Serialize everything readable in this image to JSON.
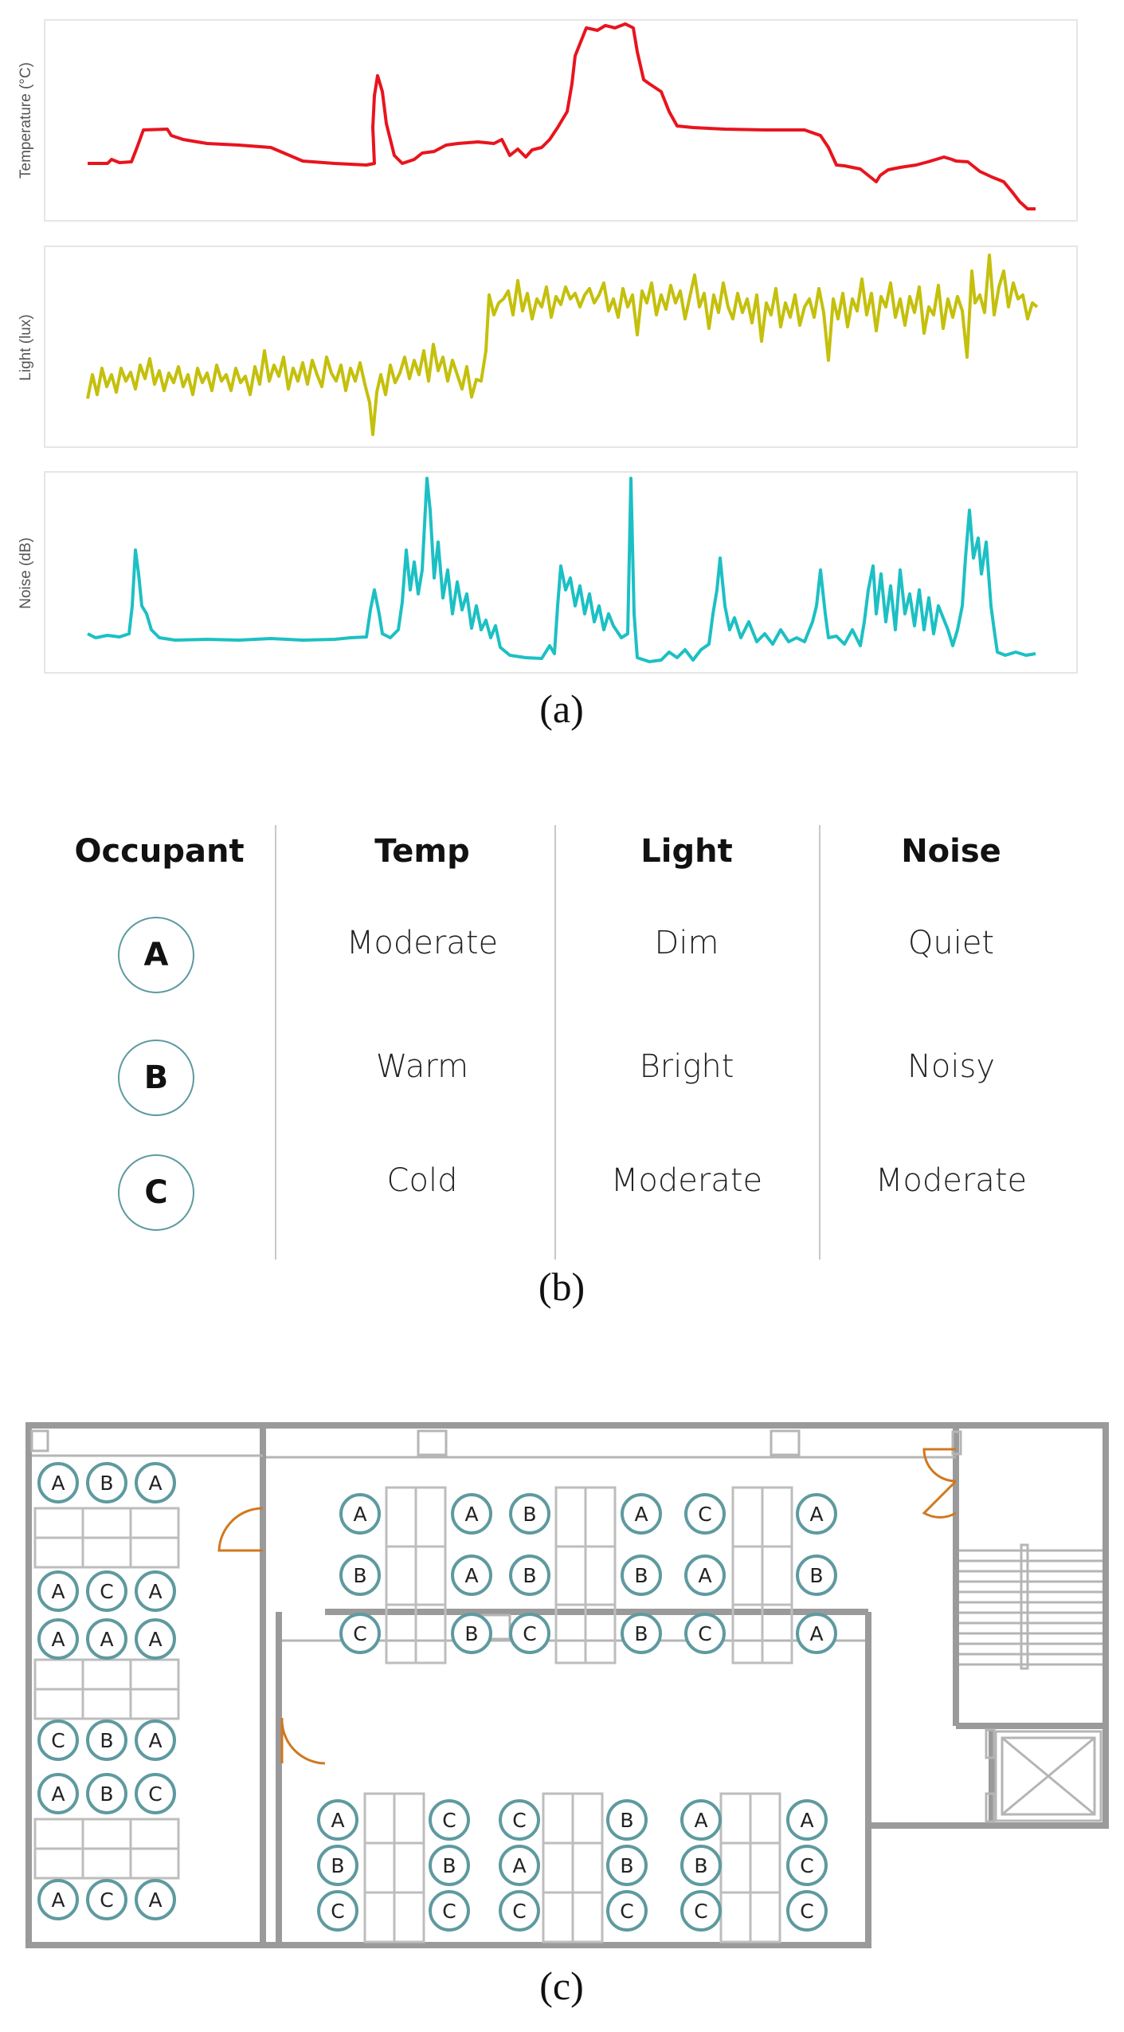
{
  "panel_a": {
    "caption": "(a)",
    "charts": [
      {
        "ylabel": "Temperature (°C)",
        "color": "#e8141e"
      },
      {
        "ylabel": "Light (lux)",
        "color": "#c4c00c"
      },
      {
        "ylabel": "Noise (dB)",
        "color": "#1cc0c4"
      }
    ]
  },
  "panel_b": {
    "caption": "(b)",
    "headers": [
      "Occupant",
      "Temp",
      "Light",
      "Noise"
    ],
    "rows": [
      {
        "occupant": "A",
        "temp": "Moderate",
        "light": "Dim",
        "noise": "Quiet"
      },
      {
        "occupant": "B",
        "temp": "Warm",
        "light": "Bright",
        "noise": "Noisy"
      },
      {
        "occupant": "C",
        "temp": "Cold",
        "light": "Moderate",
        "noise": "Moderate"
      }
    ],
    "circle_color": "#5e9aa0"
  },
  "panel_c": {
    "caption": "(c)",
    "wall_color": "#9a9a9a",
    "door_color": "#d07820",
    "seat_groups": {
      "left_column": [
        [
          "A",
          "B",
          "A"
        ],
        [
          "A",
          "C",
          "A"
        ],
        [
          "A",
          "A",
          "A"
        ],
        [
          "C",
          "B",
          "A"
        ],
        [
          "A",
          "B",
          "C"
        ],
        [
          "A",
          "C",
          "A"
        ]
      ],
      "upper_room": [
        [
          "A",
          "B",
          "C"
        ],
        [
          "A",
          "A",
          "B"
        ],
        [
          "B",
          "B",
          "C"
        ],
        [
          "A",
          "B",
          "B"
        ],
        [
          "C",
          "A",
          "C"
        ],
        [
          "A",
          "B",
          "A"
        ]
      ],
      "lower_room": [
        [
          "A",
          "B",
          "C"
        ],
        [
          "C",
          "B",
          "C"
        ],
        [
          "C",
          "A",
          "C"
        ],
        [
          "B",
          "B",
          "C"
        ],
        [
          "A",
          "B",
          "C"
        ],
        [
          "A",
          "C",
          "C"
        ]
      ]
    }
  }
}
